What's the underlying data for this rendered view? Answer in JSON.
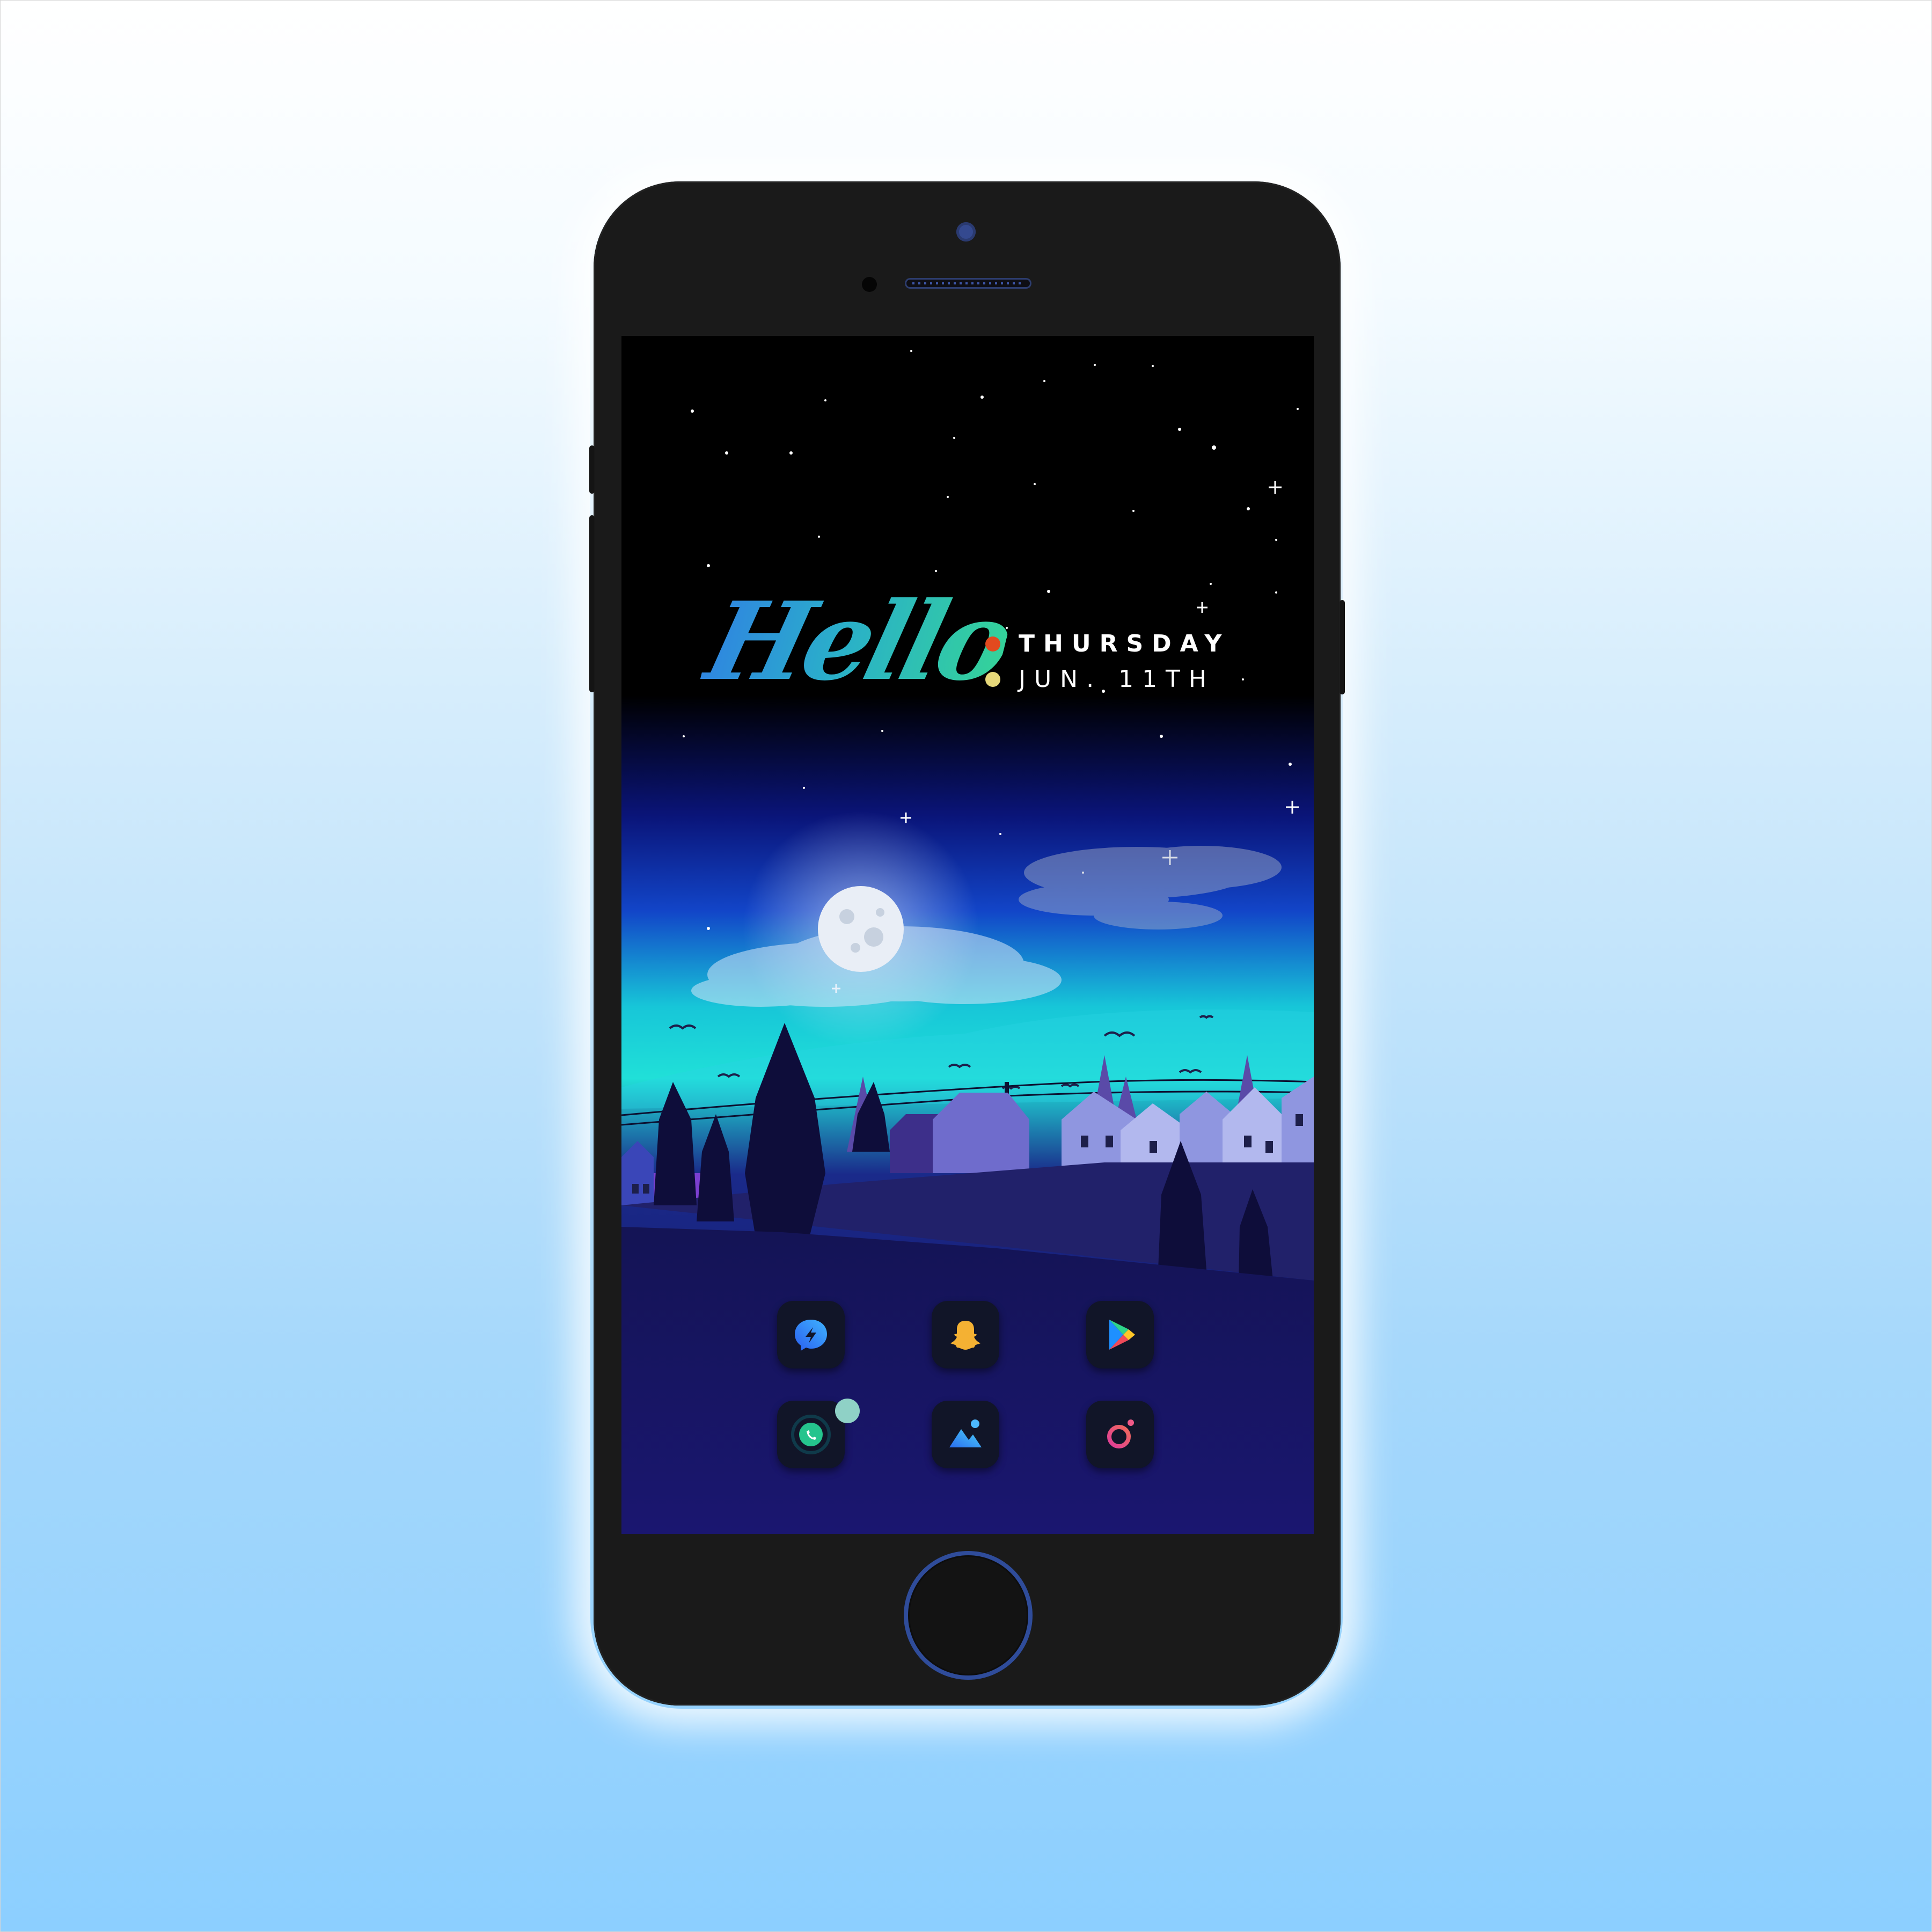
{
  "widget": {
    "greeting": "Hello",
    "day": "THURSDAY",
    "date": "JUN. 11TH",
    "day_dot_color": "#e24a1f",
    "date_dot_color": "#e6d87a"
  },
  "colors": {
    "background_top": "#ffffff",
    "background_bottom": "#8ccfff",
    "phone_body": "#1a1a1a",
    "accent": "#2f4c9a"
  },
  "dock": {
    "apps": [
      {
        "icon": "messenger-icon"
      },
      {
        "icon": "snapchat-icon"
      },
      {
        "icon": "play-store-icon"
      },
      {
        "icon": "whatsapp-icon"
      },
      {
        "icon": "gallery-icon"
      },
      {
        "icon": "instagram-icon"
      }
    ]
  }
}
